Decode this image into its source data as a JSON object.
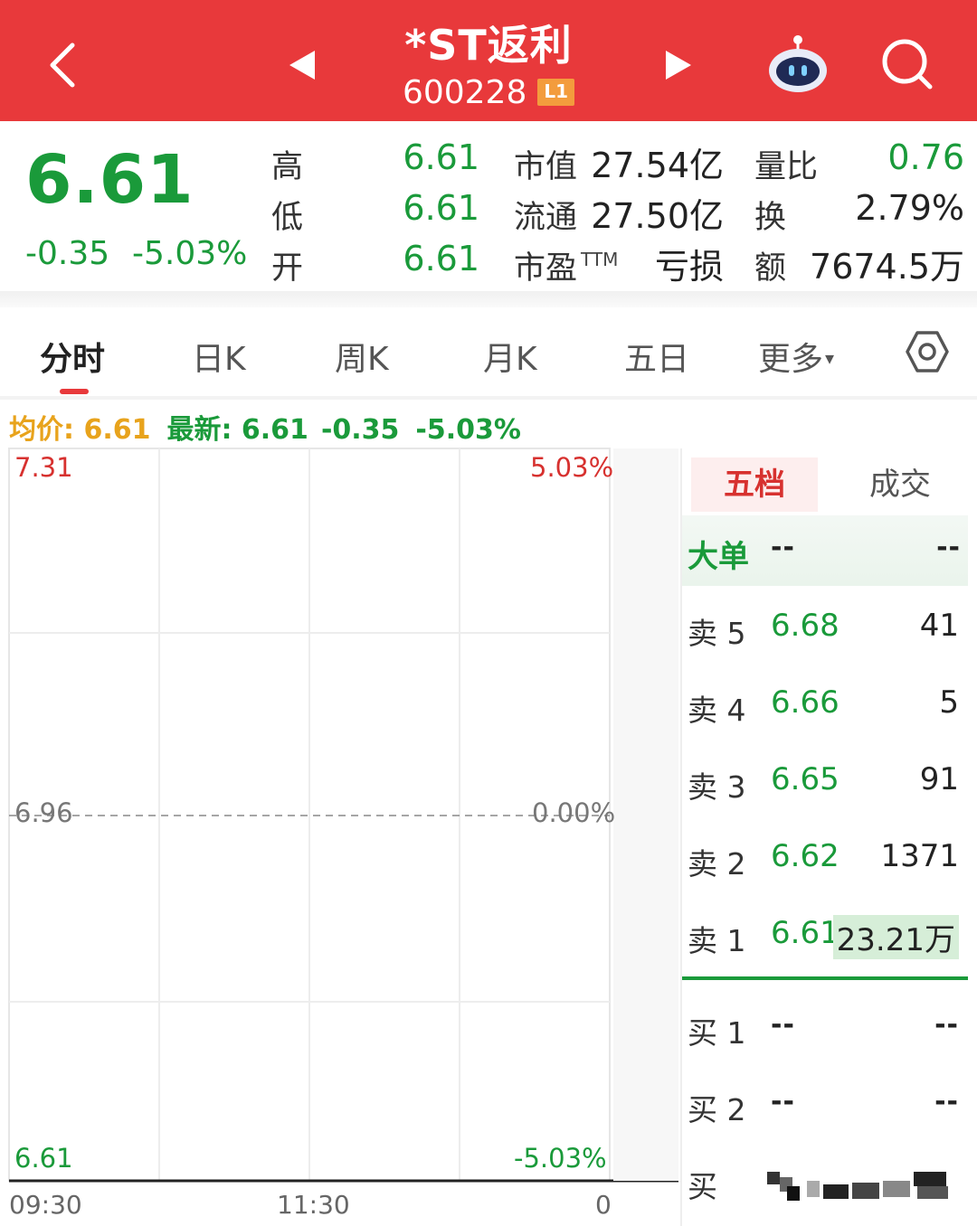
{
  "header": {
    "stock_name": "*ST返利",
    "stock_code": "600228",
    "level_badge": "L1",
    "icons": [
      "back-icon",
      "prev-icon",
      "next-icon",
      "robot-icon",
      "search-icon"
    ]
  },
  "quote": {
    "price": "6.61",
    "change": "-0.35",
    "change_pct": "-5.03%",
    "high_label": "高",
    "high": "6.61",
    "low_label": "低",
    "low": "6.61",
    "open_label": "开",
    "open": "6.61",
    "mktcap_label": "市值",
    "mktcap": "27.54亿",
    "float_label": "流通",
    "float": "27.50亿",
    "pe_label": "市盈",
    "pe_suffix": "TTM",
    "pe": "亏损",
    "volratio_label": "量比",
    "volratio": "0.76",
    "turnover_label": "换",
    "turnover": "2.79%",
    "amount_label": "额",
    "amount": "7674.5万"
  },
  "tabs": {
    "items": [
      "分时",
      "日K",
      "周K",
      "月K",
      "五日",
      "更多"
    ],
    "active": "分时",
    "more_caret": "▾"
  },
  "legend": {
    "avg": "均价: 6.61",
    "latest": "最新: 6.61",
    "change": "-0.35",
    "change_pct": "-5.03%"
  },
  "chart": {
    "y_top": "7.31",
    "y_mid": "6.96",
    "y_bottom": "6.61",
    "pct_top": "5.03%",
    "pct_mid": "0.00%",
    "pct_bottom": "-5.03%",
    "time_start": "09:30",
    "time_mid": "11:30",
    "time_end": "0"
  },
  "orderbook": {
    "tab_active": "五档",
    "tab_other": "成交",
    "big_order_label": "大单",
    "big_order_a": "--",
    "big_order_b": "--",
    "asks": [
      {
        "label": "卖 5",
        "price": "6.68",
        "vol": "41"
      },
      {
        "label": "卖 4",
        "price": "6.66",
        "vol": "5"
      },
      {
        "label": "卖 3",
        "price": "6.65",
        "vol": "91"
      },
      {
        "label": "卖 2",
        "price": "6.62",
        "vol": "1371"
      },
      {
        "label": "卖 1",
        "price": "6.61",
        "vol": "23.21万"
      }
    ],
    "bids": [
      {
        "label": "买 1",
        "price": "--",
        "vol": "--"
      },
      {
        "label": "买 2",
        "price": "--",
        "vol": "--"
      },
      {
        "label": "买"
      }
    ]
  },
  "colors": {
    "header_red": "#e8393b",
    "down_green": "#1a9a3a",
    "up_red": "#d7312f",
    "avg_yellow": "#e8a31c"
  }
}
